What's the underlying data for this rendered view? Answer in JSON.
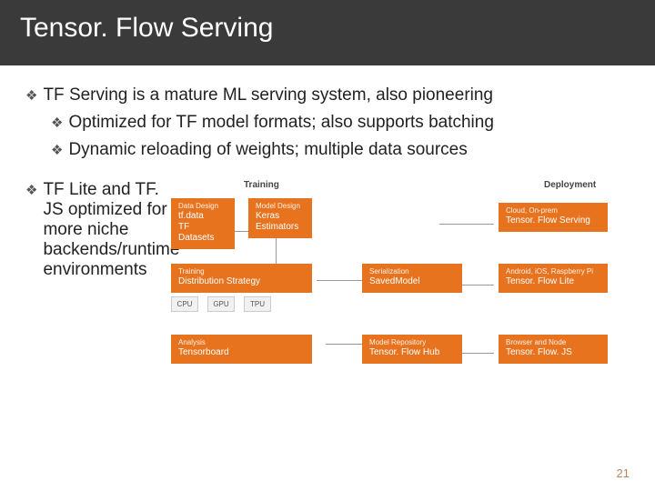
{
  "header": {
    "title": "Tensor. Flow Serving"
  },
  "bullets": {
    "main1": "TF Serving is a mature ML serving system, also pioneering",
    "sub1": "Optimized for TF model formats; also supports batching",
    "sub2": "Dynamic reloading of weights; multiple data sources",
    "main2": "TF Lite and TF. JS optimized for more niche backends/runtime environments"
  },
  "diagram": {
    "sections": {
      "training": "Training",
      "deployment": "Deployment"
    },
    "data_design": {
      "small": "Data Design",
      "l1": "tf.data",
      "l2": "TF Datasets"
    },
    "model_design": {
      "small": "Model Design",
      "l1": "Keras",
      "l2": "Estimators"
    },
    "training_box": {
      "small": "Training",
      "l1": "Distribution Strategy"
    },
    "chips": {
      "cpu": "CPU",
      "gpu": "GPU",
      "tpu": "TPU"
    },
    "analysis": {
      "small": "Analysis",
      "l1": "Tensorboard"
    },
    "serialization": {
      "small": "Serialization",
      "l1": "SavedModel"
    },
    "model_repo": {
      "small": "Model Repository",
      "l1": "Tensor. Flow Hub"
    },
    "deploy1": {
      "small": "Cloud, On-prem",
      "l1": "Tensor. Flow Serving"
    },
    "deploy2": {
      "small": "Android, iOS, Raspberry Pi",
      "l1": "Tensor. Flow Lite"
    },
    "deploy3": {
      "small": "Browser and Node",
      "l1": "Tensor. Flow. JS"
    }
  },
  "page": "21"
}
